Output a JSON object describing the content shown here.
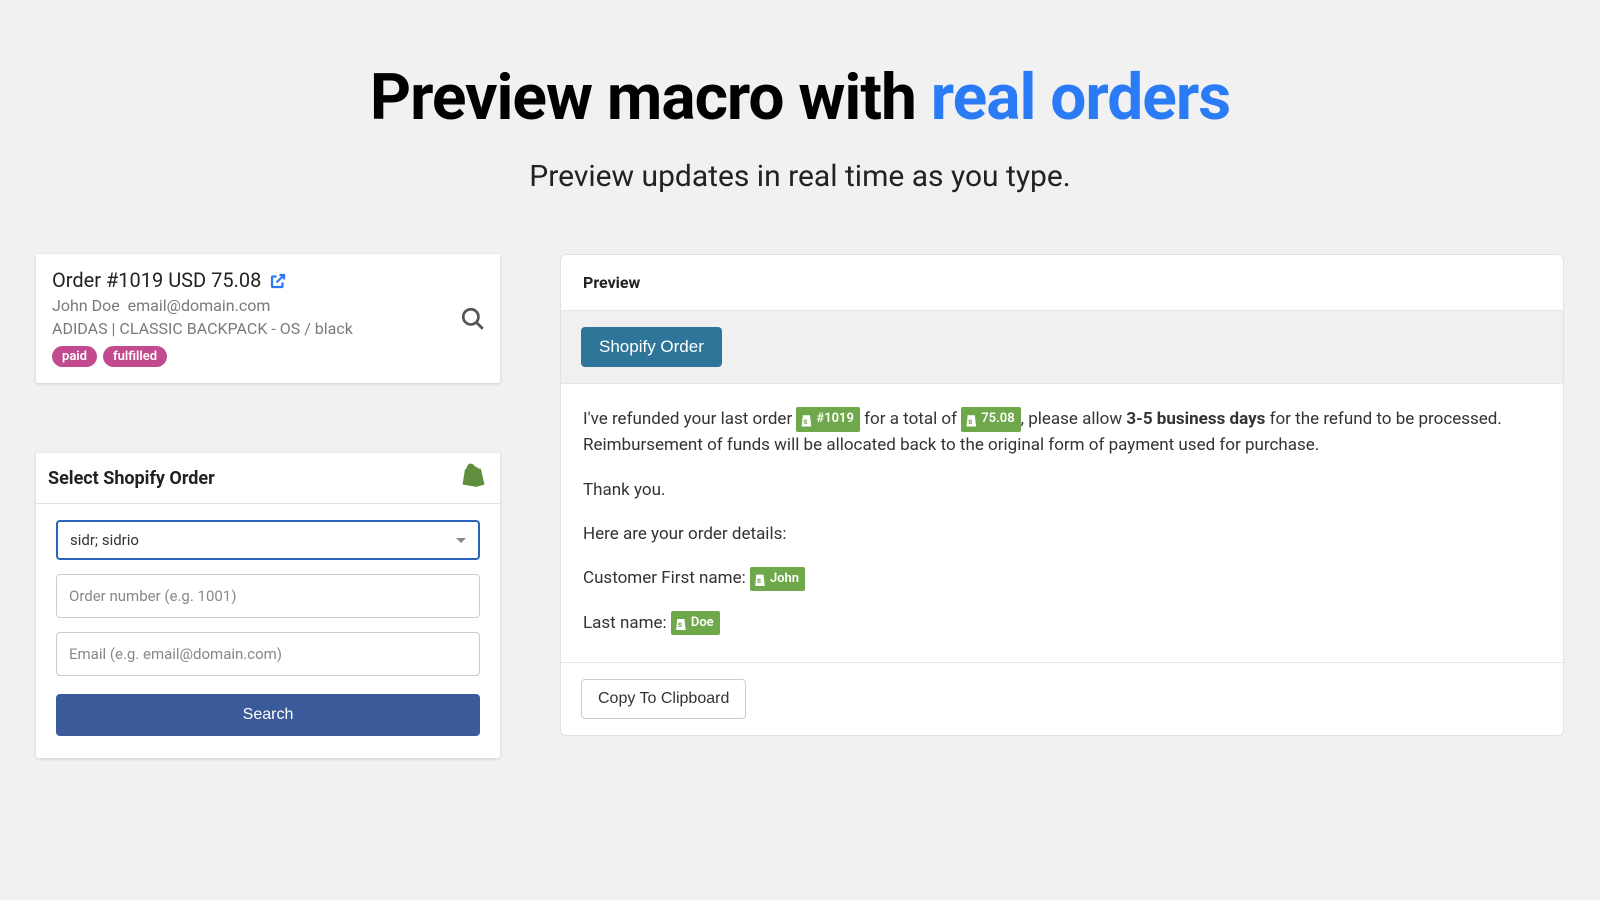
{
  "headline": {
    "prefix": "Preview macro with ",
    "accent": "real orders"
  },
  "subhead": "Preview updates in real time as you type.",
  "order_card": {
    "title": "Order #1019 USD 75.08",
    "customer_name": "John Doe",
    "customer_email": "email@domain.com",
    "line_item": "ADIDAS | CLASSIC BACKPACK - OS / black",
    "badges": [
      "paid",
      "fulfilled"
    ]
  },
  "select_panel": {
    "title": "Select Shopify Order",
    "store_value": "sidr; sidrio",
    "order_number_placeholder": "Order number (e.g. 1001)",
    "email_placeholder": "Email (e.g. email@domain.com)",
    "search_label": "Search"
  },
  "preview": {
    "head": "Preview",
    "shopify_order_btn": "Shopify Order",
    "line1_a": "I've refunded your last order ",
    "token_order": "#1019",
    "line1_b": " for a total of ",
    "token_total": "75.08",
    "line1_c": ", please allow ",
    "bold_days": "3-5 business days",
    "line1_d": " for the refund to be processed. Reimbursement of funds will be allocated back to the original form of payment used for purchase.",
    "thank_you": "Thank you.",
    "details_intro": "Here are your order details:",
    "first_name_label": "Customer First name: ",
    "token_first": "John",
    "last_name_label": "Last name: ",
    "token_last": "Doe",
    "copy_label": "Copy To Clipboard"
  }
}
